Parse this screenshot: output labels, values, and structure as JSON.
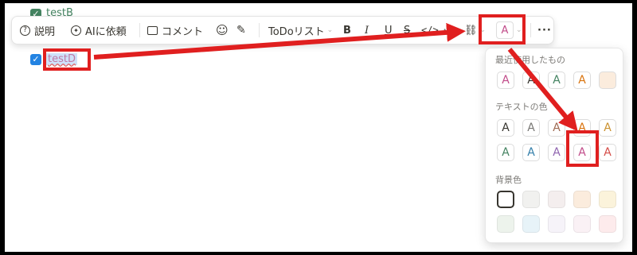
{
  "rows": [
    {
      "label": "testB",
      "checked": true,
      "checkbox_color": "#448361"
    },
    {
      "label": "testD",
      "checked": true,
      "checkbox_color": "#2383e2"
    }
  ],
  "toolbar": {
    "explain_label": "説明",
    "ai_label": "AIに依頼",
    "comment_label": "コメント",
    "todo_label": "ToDoリスト",
    "color_button_glyph": "A"
  },
  "color_panel": {
    "recent_title": "最近使用したもの",
    "text_color_title": "テキストの色",
    "background_title": "背景色",
    "recent": [
      {
        "glyph": "A",
        "color": "#c14c8a",
        "bg": "#ffffff"
      },
      {
        "glyph": "A",
        "color": "#37352f",
        "bg": "#ffffff"
      },
      {
        "glyph": "A",
        "color": "#448361",
        "bg": "#ffffff"
      },
      {
        "glyph": "A",
        "color": "#d9730d",
        "bg": "#ffffff"
      },
      {
        "glyph": "",
        "color": "#d9730d",
        "bg": "#fbecdd"
      }
    ],
    "text_colors": [
      {
        "glyph": "A",
        "color": "#37352f"
      },
      {
        "glyph": "A",
        "color": "#787774"
      },
      {
        "glyph": "A",
        "color": "#9f6b53"
      },
      {
        "glyph": "A",
        "color": "#d9730d"
      },
      {
        "glyph": "A",
        "color": "#cb912f"
      },
      {
        "glyph": "A",
        "color": "#448361"
      },
      {
        "glyph": "A",
        "color": "#337ea9"
      },
      {
        "glyph": "A",
        "color": "#9065b0"
      },
      {
        "glyph": "A",
        "color": "#c14c8a"
      },
      {
        "glyph": "A",
        "color": "#d44c47"
      }
    ],
    "background_colors": [
      "#ffffff",
      "#f1f1ef",
      "#f4eeee",
      "#fbecdd",
      "#fbf3db",
      "#edf3ec",
      "#e7f3f8",
      "#f6f3f9",
      "#faf1f5",
      "#fdebec"
    ],
    "accent_color": "#e01f1f"
  }
}
